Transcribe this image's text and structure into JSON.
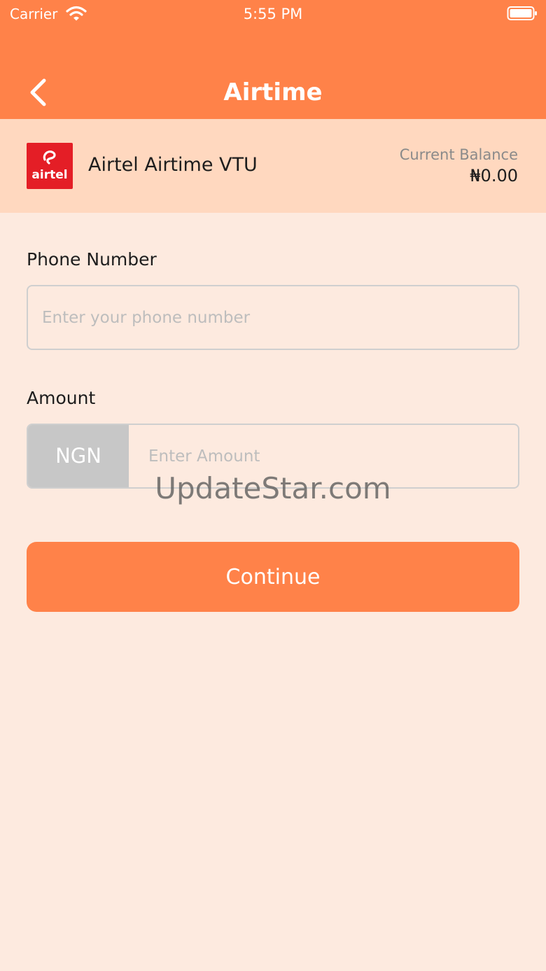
{
  "status_bar": {
    "carrier": "Carrier",
    "time": "5:55 PM",
    "wifi_icon": "wifi-icon",
    "battery_icon": "battery-icon"
  },
  "header": {
    "title": "Airtime",
    "back_icon": "chevron-left-icon"
  },
  "provider": {
    "logo_text": "airtel",
    "name": "Airtel Airtime VTU",
    "balance_label": "Current Balance",
    "balance_value": "₦0.00"
  },
  "form": {
    "phone_label": "Phone Number",
    "phone_placeholder": "Enter your phone number",
    "phone_value": "",
    "amount_label": "Amount",
    "currency": "NGN",
    "amount_placeholder": "Enter Amount",
    "amount_value": "",
    "continue_label": "Continue"
  },
  "watermark": "UpdateStar.com",
  "colors": {
    "accent": "#FF8249",
    "provider_bar": "#FFD8BF",
    "background": "#FDEADF",
    "airtel_red": "#E41E26",
    "currency_box": "#C7C7C7"
  }
}
